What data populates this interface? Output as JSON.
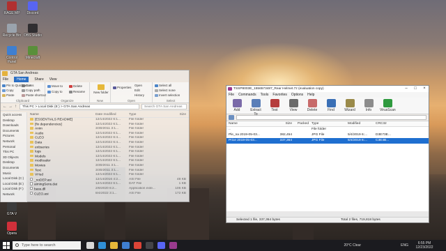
{
  "desktop": {
    "icons": [
      {
        "label": "RAGE MP",
        "color": "#b03030"
      },
      {
        "label": "Discord",
        "color": "#5865f2"
      },
      {
        "label": "Recycle Bin",
        "color": "#9aa3ad"
      },
      {
        "label": "OBS Studio",
        "color": "#302e31"
      },
      {
        "label": "Control Panel",
        "color": "#3f7fd0"
      },
      {
        "label": "Minecraft",
        "color": "#5a8f3a"
      },
      {
        "label": "GTA V",
        "color": "#3b3b3b"
      },
      {
        "label": "Opera",
        "color": "#d0303a"
      }
    ]
  },
  "explorer": {
    "title": "GTA San Andreas",
    "tabs": [
      "File",
      "Home",
      "Share",
      "View"
    ],
    "active_tab": "Home",
    "ribbon": {
      "clipboard": {
        "label": "Clipboard",
        "items": [
          "Pin to Quick access",
          "Copy",
          "Paste",
          "Cut",
          "Copy path",
          "Paste shortcut"
        ]
      },
      "organize": {
        "label": "Organize",
        "items": [
          "Move to",
          "Copy to",
          "Delete",
          "Rename"
        ]
      },
      "new": {
        "label": "New",
        "items": [
          "New folder"
        ]
      },
      "open": {
        "label": "Open",
        "items": [
          "Properties",
          "Open",
          "Edit",
          "History"
        ]
      },
      "select": {
        "label": "Select",
        "items": [
          "Select all",
          "Select none",
          "Invert selection"
        ]
      }
    },
    "address": "This PC  >  Local Disk (E:)  >  GTA San Andreas",
    "search_placeholder": "Search GTA San Andreas",
    "nav_items": [
      "Quick access",
      "Desktop",
      "Downloads",
      "Documents",
      "Pictures",
      "Network",
      "Personal",
      "This PC",
      "3D Objects",
      "Desktop",
      "Documents",
      "Music",
      "Local Disk (C:)",
      "Local Disk (E:)",
      "Local Disk (F:)",
      "Network"
    ],
    "columns": {
      "name": "Name",
      "date": "Date modified",
      "type": "Type",
      "size": "Size"
    },
    "rows": [
      {
        "name": "[ESSENTIALS README]",
        "date": "12/14/2022 6:1...",
        "type": "File folder",
        "size": "",
        "kind": "folder"
      },
      {
        "name": "[fix dependencies]",
        "date": "12/14/2022 6:1...",
        "type": "File folder",
        "size": "",
        "kind": "folder"
      },
      {
        "name": "Anim",
        "date": "3/30/2011 3:1...",
        "type": "File folder",
        "size": "",
        "kind": "folder"
      },
      {
        "name": "Audio",
        "date": "12/14/2022 6:1...",
        "type": "File folder",
        "size": "",
        "kind": "folder"
      },
      {
        "name": "CLEO",
        "date": "12/14/2022 6:4...",
        "type": "File folder",
        "size": "",
        "kind": "folder"
      },
      {
        "name": "Data",
        "date": "12/14/2022 6:4...",
        "type": "File folder",
        "size": "",
        "kind": "folder"
      },
      {
        "name": "enbseries",
        "date": "12/14/2022 6:1...",
        "type": "File folder",
        "size": "",
        "kind": "folder"
      },
      {
        "name": "logs",
        "date": "12/14/2022 6:1...",
        "type": "File folder",
        "size": "",
        "kind": "folder"
      },
      {
        "name": "Models",
        "date": "12/14/2022 6:1...",
        "type": "File folder",
        "size": "",
        "kind": "folder"
      },
      {
        "name": "modloader",
        "date": "12/14/2022 6:1...",
        "type": "File folder",
        "size": "",
        "kind": "folder"
      },
      {
        "name": "Movies",
        "date": "3/30/2011 3:1...",
        "type": "File folder",
        "size": "",
        "kind": "folder"
      },
      {
        "name": "Text",
        "date": "3/30/2011 3:1...",
        "type": "File folder",
        "size": "",
        "kind": "folder"
      },
      {
        "name": "VHud",
        "date": "12/14/2022 6:1...",
        "type": "File folder",
        "size": "",
        "kind": "folder"
      },
      {
        "name": "_noDEP.asi",
        "date": "12/14/2016 4:2...",
        "type": "ASI File",
        "size": "48 KB",
        "kind": "file"
      },
      {
        "name": "aimingSens.dat",
        "date": "12/14/2022 6:1...",
        "type": "DAT File",
        "size": "1 KB",
        "kind": "file"
      },
      {
        "name": "bass.dll",
        "date": "2/8/2020 6:2...",
        "type": "Application exte...",
        "size": "106 KB",
        "kind": "file"
      },
      {
        "name": "CLEO.asi",
        "date": "8/4/2022 3:1...",
        "type": "ASI File",
        "size": "172 KB",
        "kind": "file"
      }
    ]
  },
  "winrar": {
    "title": "TSSP8003E_1556573487_Rear Helmet.7z (evaluation copy)",
    "menu": [
      "File",
      "Commands",
      "Tools",
      "Favorites",
      "Options",
      "Help"
    ],
    "toolbar": [
      {
        "label": "Add",
        "color": "#7a6aa8"
      },
      {
        "label": "Extract To",
        "color": "#5b7fb8"
      },
      {
        "label": "Test",
        "color": "#b53d3d"
      },
      {
        "label": "View",
        "color": "#6a6a6a"
      },
      {
        "label": "Delete",
        "color": "#c76a6a"
      },
      {
        "label": "Find",
        "color": "#3a6fb5"
      },
      {
        "label": "Wizard",
        "color": "#9a8a4a"
      },
      {
        "label": "Info",
        "color": "#8c8c8c"
      },
      {
        "label": "VirusScan",
        "color": "#2f9a3f"
      }
    ],
    "columns": {
      "name": "Name",
      "size": "Size",
      "packed": "Packed",
      "type": "Type",
      "modified": "Modified",
      "crc": "CRC32"
    },
    "rows": [
      {
        "name": "..",
        "size": "",
        "packed": "",
        "type": "File folder",
        "modified": "",
        "crc": "",
        "selected": false
      },
      {
        "name": "Ple_na 2019-05-03...",
        "size": "382,454",
        "packed": "",
        "type": "JPG File",
        "modified": "5/4/2019 6:...",
        "crc": "D3E73E...",
        "selected": false
      },
      {
        "name": "Price 2019-05-03...",
        "size": "337,364",
        "packed": "",
        "type": "JPG File",
        "modified": "5/4/2019 6:...",
        "crc": "C3E4B...",
        "selected": true
      }
    ],
    "status_left": "Selected 1 file, 337,364 bytes",
    "status_right": "Total 2 files, 719,818 bytes"
  },
  "taskbar": {
    "search_placeholder": "Type here to search",
    "apps": [
      {
        "name": "task-view",
        "color": "#d8d8d8"
      },
      {
        "name": "edge",
        "color": "#2f8fd8"
      },
      {
        "name": "file-explorer",
        "color": "#e6b83a"
      },
      {
        "name": "mail",
        "color": "#3f7fd0"
      },
      {
        "name": "chrome",
        "color": "#dc4437"
      },
      {
        "name": "obs",
        "color": "#444448"
      },
      {
        "name": "discord",
        "color": "#5865f2"
      },
      {
        "name": "winrar",
        "color": "#9a3b8e"
      }
    ],
    "weather": "20°C  Clear",
    "lang": "ENG",
    "time": "6:55 PM",
    "date": "12/23/2022"
  }
}
